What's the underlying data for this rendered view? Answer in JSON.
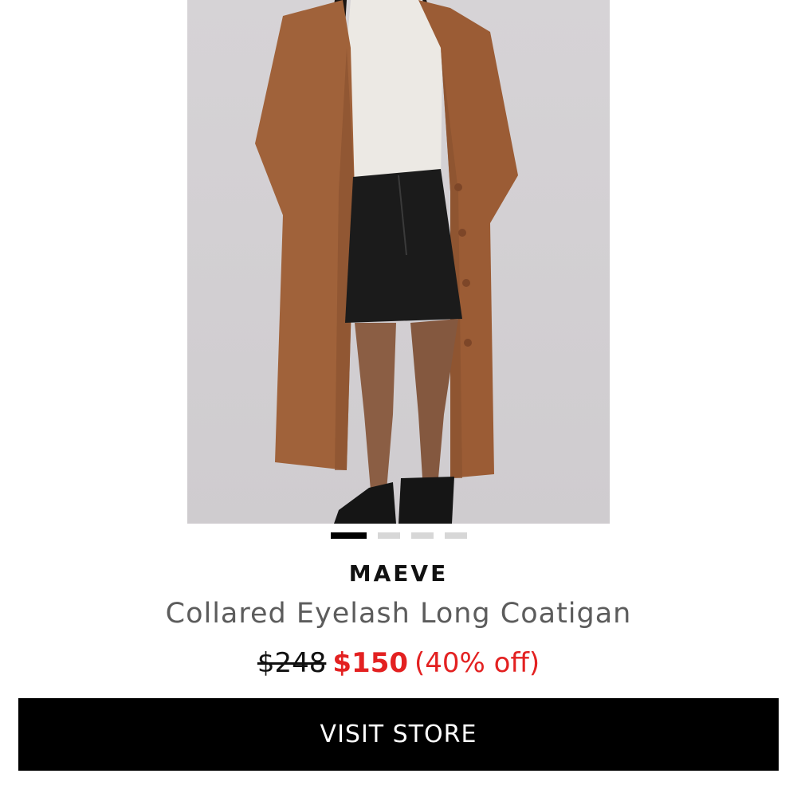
{
  "product": {
    "image_alt": "Model wearing a long brown fuzzy coatigan over a white top and black leather mini skirt with black boots",
    "brand": "MAEVE",
    "name": "Collared Eyelash Long Coatigan",
    "price_original": "$248",
    "price_sale": "$150",
    "discount": "(40% off)"
  },
  "carousel": {
    "total": 4,
    "active_index": 0
  },
  "cta": {
    "label": "VISIT STORE"
  },
  "colors": {
    "sale": "#e32121",
    "button_bg": "#000000",
    "button_text": "#ffffff",
    "coat": "#a0623a"
  }
}
